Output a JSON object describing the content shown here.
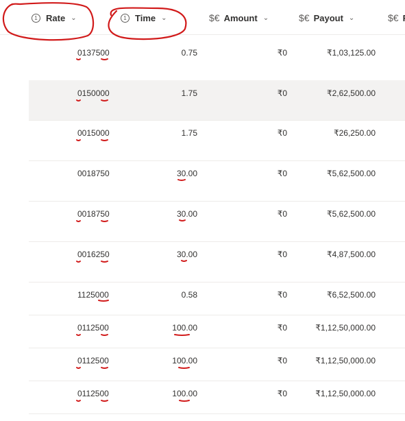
{
  "columns": [
    {
      "label": "Rate",
      "icon": "1"
    },
    {
      "label": "Time",
      "icon": "1"
    },
    {
      "label": "Amount",
      "icon": "$€"
    },
    {
      "label": "Payout",
      "icon": "$€"
    },
    {
      "label": "F",
      "icon": "$€"
    }
  ],
  "rows": [
    {
      "rate": "0137500",
      "time": "0.75",
      "amount": "₹0",
      "payout": "₹1,03,125.00"
    },
    {
      "rate": "0150000",
      "time": "1.75",
      "amount": "₹0",
      "payout": "₹2,62,500.00"
    },
    {
      "rate": "0015000",
      "time": "1.75",
      "amount": "₹0",
      "payout": "₹26,250.00"
    },
    {
      "rate": "0018750",
      "time": "30.00",
      "amount": "₹0",
      "payout": "₹5,62,500.00"
    },
    {
      "rate": "0018750",
      "time": "30.00",
      "amount": "₹0",
      "payout": "₹5,62,500.00"
    },
    {
      "rate": "0016250",
      "time": "30.00",
      "amount": "₹0",
      "payout": "₹4,87,500.00"
    },
    {
      "rate": "1125000",
      "time": "0.58",
      "amount": "₹0",
      "payout": "₹6,52,500.00"
    },
    {
      "rate": "0112500",
      "time": "100.00",
      "amount": "₹0",
      "payout": "₹1,12,50,000.00"
    },
    {
      "rate": "0112500",
      "time": "100.00",
      "amount": "₹0",
      "payout": "₹1,12,50,000.00"
    },
    {
      "rate": "0112500",
      "time": "100.00",
      "amount": "₹0",
      "payout": "₹1,12,50,000.00"
    }
  ],
  "colors": {
    "annotation": "#d11a1a",
    "selected_row": "#f3f2f1",
    "divider": "#edebe9"
  }
}
